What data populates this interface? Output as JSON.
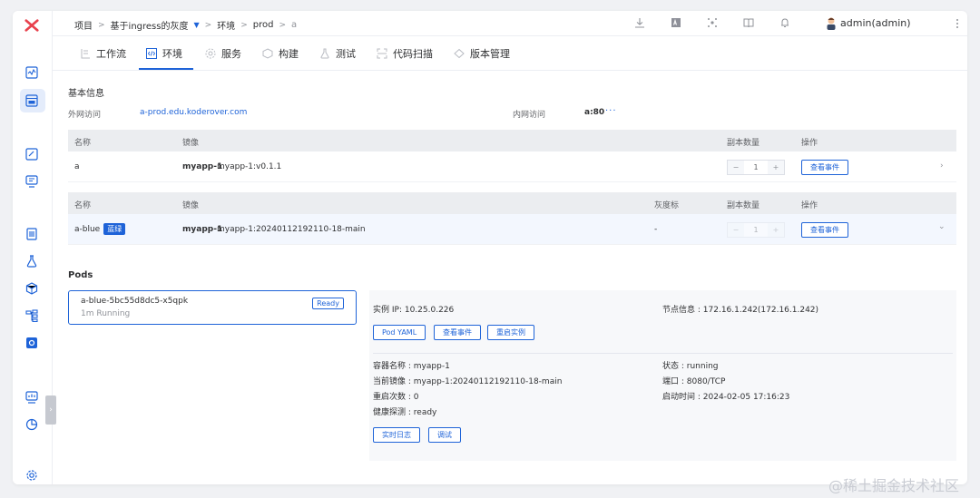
{
  "breadcrumb": {
    "items": [
      "项目",
      "基于ingress的灰度",
      "环境",
      "prod",
      "a"
    ],
    "separator": ">"
  },
  "user": {
    "name": "admin(admin)"
  },
  "tabs": [
    {
      "label": "工作流",
      "icon": "workflow-icon"
    },
    {
      "label": "环境",
      "icon": "code-icon",
      "active": true
    },
    {
      "label": "服务",
      "icon": "service-icon"
    },
    {
      "label": "构建",
      "icon": "build-icon"
    },
    {
      "label": "测试",
      "icon": "test-icon"
    },
    {
      "label": "代码扫描",
      "icon": "scan-icon"
    },
    {
      "label": "版本管理",
      "icon": "version-icon"
    }
  ],
  "basic_info": {
    "title": "基本信息",
    "external_label": "外网访问",
    "external_value": "a-prod.edu.koderover.com",
    "internal_label": "内网访问",
    "internal_value": "a:80",
    "more": "···"
  },
  "table1": {
    "headers": {
      "name": "名称",
      "image": "镜像",
      "replicas": "副本数量",
      "ops": "操作"
    },
    "row": {
      "name": "a",
      "image_name": "myapp-1",
      "image_tag": "myapp-1:v0.1.1",
      "minus": "−",
      "count": "1",
      "plus": "+",
      "action": "查看事件",
      "chevron": "›"
    }
  },
  "table2": {
    "headers": {
      "name": "名称",
      "image": "镜像",
      "gray": "灰度标",
      "replicas": "副本数量",
      "ops": "操作"
    },
    "row": {
      "name": "a-blue",
      "tag": "蓝绿",
      "image_name": "myapp-1",
      "image_tag": "myapp-1:20240112192110-18-main",
      "gray": "-",
      "minus": "−",
      "count": "1",
      "plus": "+",
      "action": "查看事件",
      "chevron": "⌄"
    }
  },
  "pods": {
    "title": "Pods",
    "card": {
      "name": "a-blue-5bc55d8dc5-x5qpk",
      "status": "1m  Running",
      "ready": "Ready"
    }
  },
  "detail": {
    "ip_label": "实例 IP:",
    "ip": "10.25.0.226",
    "node_label": "节点信息 :",
    "node": "172.16.1.242(172.16.1.242)",
    "buttons": {
      "yaml": "Pod YAML",
      "events": "查看事件",
      "restart": "重启实例",
      "logs": "实时日志",
      "debug": "调试"
    },
    "container_label": "容器名称 :",
    "container": "myapp-1",
    "image_label": "当前镜像 :",
    "image": "myapp-1:20240112192110-18-main",
    "restart_label": "重启次数 :",
    "restart": "0",
    "health_label": "健康探测 :",
    "health": "ready",
    "state_label": "状态 :",
    "state": "running",
    "port_label": "端口 :",
    "port": "8080/TCP",
    "start_label": "启动时间 :",
    "start": "2024-02-05 17:16:23"
  },
  "watermark": "@稀土掘金技术社区",
  "colors": {
    "accent": "#1e63d8",
    "brand": "#e8414d",
    "header_bg": "#ebedf0"
  }
}
